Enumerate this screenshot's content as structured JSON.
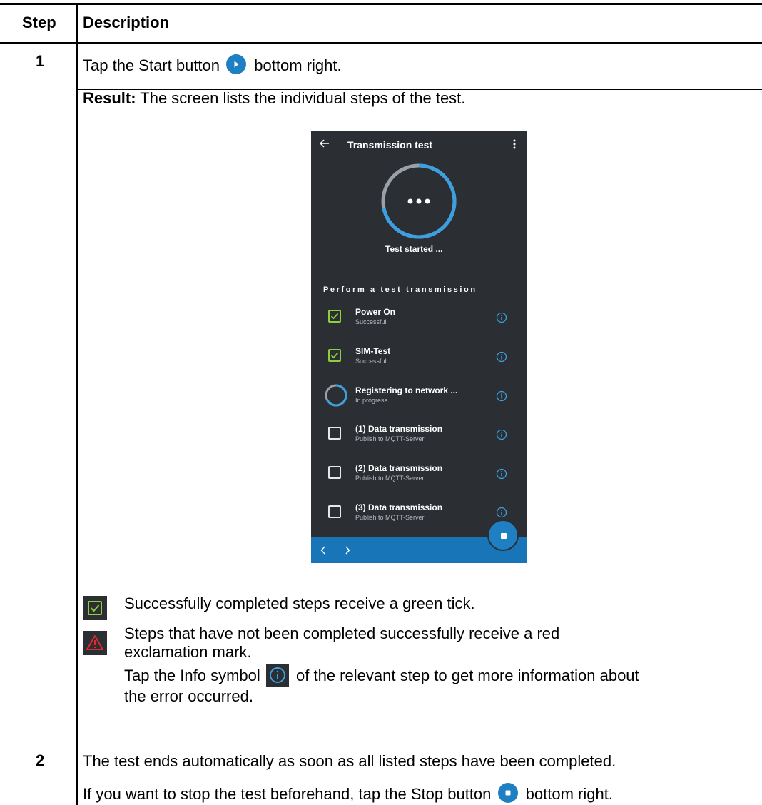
{
  "table": {
    "header": {
      "step": "Step",
      "description": "Description"
    },
    "row1": {
      "step": "1",
      "instruction_pre": "Tap the Start button",
      "instruction_post": "bottom right.",
      "result_label": "Result:",
      "result_text": "The screen lists the individual steps of the test.",
      "legend_success": "Successfully completed steps receive a green tick.",
      "legend_error_line1": "Steps that have not been completed successfully receive a red",
      "legend_error_line2": "exclamation mark.",
      "info_pre": "Tap the Info symbol",
      "info_post": "of the relevant step to get more information about",
      "info_line2": "the error occurred."
    },
    "row2": {
      "step": "2",
      "line1": "The test ends automatically as soon as all listed steps have been completed.",
      "line2_pre": "If you want to stop the test beforehand, tap the Stop button",
      "line2_post": "bottom right."
    }
  },
  "phone": {
    "title": "Transmission test",
    "status": "Test started ...",
    "progress_fraction": 0.72,
    "section_title": "Perform a test transmission",
    "steps": [
      {
        "name": "Power On",
        "sub": "Successful",
        "state": "done"
      },
      {
        "name": "SIM-Test",
        "sub": "Successful",
        "state": "done"
      },
      {
        "name": "Registering to network ...",
        "sub": "In progress",
        "state": "progress"
      },
      {
        "name": "(1) Data transmission",
        "sub": "Publish to MQTT-Server",
        "state": "pending"
      },
      {
        "name": "(2) Data transmission",
        "sub": "Publish to MQTT-Server",
        "state": "pending"
      },
      {
        "name": "(3) Data transmission",
        "sub": "Publish to MQTT-Server",
        "state": "pending"
      }
    ]
  },
  "colors": {
    "accent_blue": "#1e7fc3",
    "success_green": "#8fcf3c",
    "error_red": "#e0282e",
    "phone_bg": "#2b2e33"
  },
  "icons": [
    "play-icon",
    "stop-icon",
    "info-icon",
    "green-tick-icon",
    "red-warning-icon",
    "back-arrow-icon",
    "more-menu-icon"
  ]
}
